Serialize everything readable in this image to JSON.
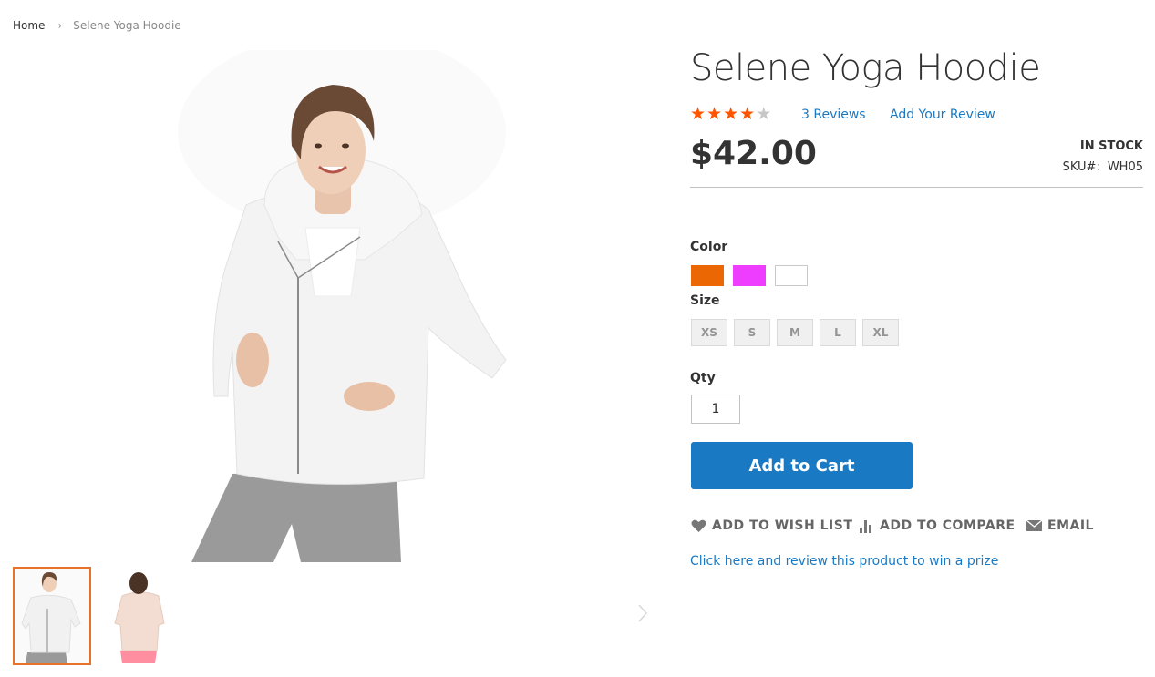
{
  "breadcrumb": {
    "home": "Home",
    "separator": "›",
    "current": "Selene Yoga Hoodie"
  },
  "product": {
    "title": "Selene Yoga Hoodie",
    "rating": {
      "stars_filled": 4,
      "stars_total": 5
    },
    "reviews_link": "3 Reviews",
    "add_review_link": "Add Your Review",
    "price": "$42.00",
    "stock": "IN STOCK",
    "sku_label": "SKU#:",
    "sku_value": "WH05"
  },
  "options": {
    "color_label": "Color",
    "colors": [
      {
        "name": "orange",
        "hex": "#eb6703"
      },
      {
        "name": "purple",
        "hex": "#ef3dff"
      },
      {
        "name": "white",
        "hex": "#ffffff"
      }
    ],
    "size_label": "Size",
    "sizes": [
      "XS",
      "S",
      "M",
      "L",
      "XL"
    ],
    "qty_label": "Qty",
    "qty_value": "1"
  },
  "actions": {
    "add_to_cart": "Add to Cart",
    "wish_list": "ADD TO WISH LIST",
    "compare": "ADD TO COMPARE",
    "email": "EMAIL",
    "review_prize": "Click here and review this product to win a prize"
  },
  "gallery": {
    "main_image_alt": "model-wearing-white-hoodie",
    "thumbnails": [
      "front-view",
      "back-view"
    ],
    "active_thumbnail": 0
  },
  "colors": {
    "accent_blue": "#1979c3",
    "star_orange": "#ff5501",
    "thumb_active_border": "#e8722a"
  }
}
